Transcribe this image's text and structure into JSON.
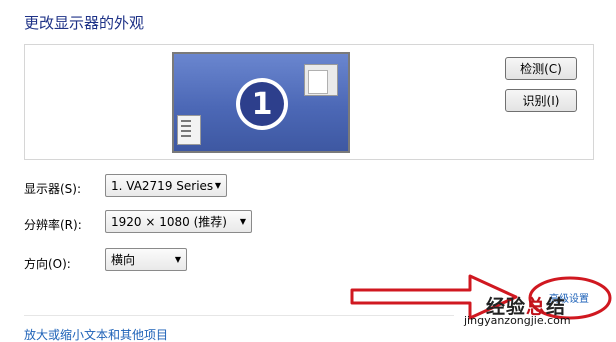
{
  "header": {
    "title": "更改显示器的外观"
  },
  "preview": {
    "monitor_number": "1",
    "detect_label": "检测(C)",
    "identify_label": "识别(I)"
  },
  "settings": {
    "display_label": "显示器(S):",
    "display_value": "1. VA2719 Series",
    "resolution_label": "分辨率(R):",
    "resolution_value": "1920 × 1080 (推荐)",
    "orientation_label": "方向(O):",
    "orientation_value": "横向"
  },
  "advanced_link": "高级设置",
  "watermark": {
    "text_dark": "经验",
    "text_red": "总",
    "text_dark2": "结",
    "url": "jingyanzongjie.com"
  },
  "footer": {
    "link": "放大或缩小文本和其他项目"
  },
  "colors": {
    "title": "#1e3287",
    "link": "#1e62b8",
    "annotation": "#d01820"
  },
  "icons": [
    "monitor-icon",
    "dropdown-arrow-icon",
    "annotation-arrow-icon",
    "annotation-circle-icon"
  ]
}
